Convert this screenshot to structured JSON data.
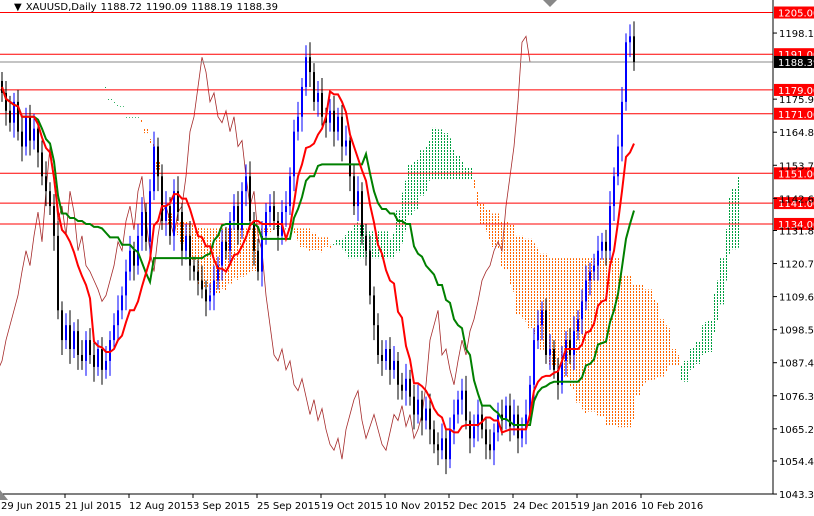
{
  "header": {
    "symbol": "XAUUSD,Daily",
    "open": "1188.72",
    "high": "1190.09",
    "low": "1188.19",
    "close": "1188.39"
  },
  "chart_data": {
    "type": "candlestick",
    "title": "XAUUSD,Daily",
    "ylim": [
      1043.3,
      1205.0
    ],
    "grid": false,
    "x_tick_labels": [
      "29 Jun 2015",
      "21 Jul 2015",
      "12 Aug 2015",
      "3 Sep 2015",
      "25 Sep 2015",
      "19 Oct 2015",
      "10 Nov 2015",
      "2 Dec 2015",
      "24 Dec 2015",
      "19 Jan 2016",
      "10 Feb 2016"
    ],
    "y_tick_labels": [
      "1198.10",
      "1175.90",
      "1164.80",
      "1153.70",
      "1142.60",
      "1131.80",
      "1120.70",
      "1109.60",
      "1098.50",
      "1087.40",
      "1076.30",
      "1065.20",
      "1054.40",
      "1043.30"
    ],
    "closes": [
      1178,
      1172,
      1168,
      1175,
      1165,
      1160,
      1170,
      1162,
      1166,
      1158,
      1150,
      1145,
      1140,
      1130,
      1105,
      1095,
      1100,
      1092,
      1098,
      1090,
      1088,
      1095,
      1090,
      1086,
      1092,
      1085,
      1088,
      1095,
      1100,
      1105,
      1110,
      1118,
      1125,
      1120,
      1130,
      1138,
      1128,
      1145,
      1160,
      1150,
      1135,
      1140,
      1130,
      1145,
      1138,
      1125,
      1130,
      1120,
      1118,
      1115,
      1112,
      1108,
      1110,
      1115,
      1120,
      1128,
      1125,
      1135,
      1140,
      1132,
      1145,
      1150,
      1135,
      1125,
      1118,
      1130,
      1138,
      1140,
      1135,
      1130,
      1138,
      1140,
      1150,
      1165,
      1170,
      1180,
      1190,
      1185,
      1175,
      1178,
      1170,
      1168,
      1172,
      1165,
      1170,
      1160,
      1162,
      1150,
      1140,
      1145,
      1130,
      1125,
      1110,
      1100,
      1090,
      1088,
      1092,
      1085,
      1088,
      1080,
      1078,
      1082,
      1076,
      1070,
      1075,
      1068,
      1072,
      1065,
      1060,
      1058,
      1062,
      1055,
      1065,
      1070,
      1075,
      1078,
      1068,
      1062,
      1066,
      1070,
      1065,
      1060,
      1058,
      1064,
      1070,
      1068,
      1073,
      1066,
      1070,
      1062,
      1065,
      1070,
      1080,
      1095,
      1100,
      1105,
      1090,
      1092,
      1085,
      1080,
      1088,
      1095,
      1090,
      1098,
      1102,
      1108,
      1115,
      1118,
      1120,
      1125,
      1128,
      1125,
      1140,
      1150,
      1160,
      1175,
      1195,
      1197,
      1188.39
    ],
    "levels": [
      {
        "value": 1205.0,
        "label": "1205.00"
      },
      {
        "value": 1191.0,
        "label": "1191.00"
      },
      {
        "value": 1179.0,
        "label": "1179.00"
      },
      {
        "value": 1171.0,
        "label": "1171.00"
      },
      {
        "value": 1151.0,
        "label": "1151.00"
      },
      {
        "value": 1141.0,
        "label": "1141.00"
      },
      {
        "value": 1134.0,
        "label": "1134.00"
      }
    ],
    "current_price": {
      "value": 1188.39,
      "label": "1188.39"
    },
    "indicators": [
      "Ichimoku Tenkan-sen",
      "Ichimoku Kijun-sen",
      "Ichimoku Chikou",
      "Ichimoku Cloud"
    ],
    "colors": {
      "bull": "#0000ff",
      "bear": "#000000",
      "tenkan": "#ff0000",
      "kijun": "#008000",
      "chikou": "#a52a2a",
      "cloud_bear": "#ff6600",
      "cloud_bull": "#00a040",
      "level": "#ff0000"
    }
  }
}
